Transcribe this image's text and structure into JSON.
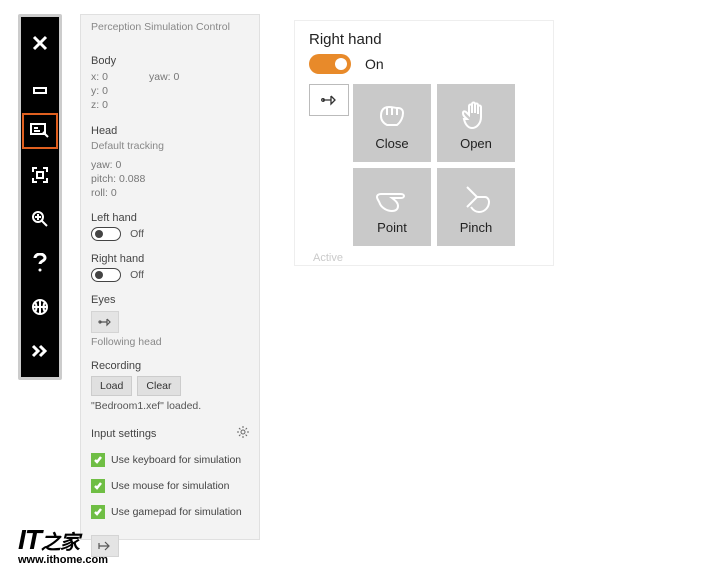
{
  "toolbar": {
    "items": [
      "close",
      "minimize",
      "perception",
      "fit-screen",
      "zoom",
      "help",
      "globe",
      "expand"
    ]
  },
  "panel": {
    "title": "Perception Simulation Control",
    "body": {
      "heading": "Body",
      "x_label": "x:",
      "x_val": "0",
      "y_label": "y:",
      "y_val": "0",
      "z_label": "z:",
      "z_val": "0",
      "yaw_label": "yaw:",
      "yaw_val": "0"
    },
    "head": {
      "heading": "Head",
      "tracking": "Default tracking",
      "yaw_label": "yaw:",
      "yaw_val": "0",
      "pitch_label": "pitch:",
      "pitch_val": "0.088",
      "roll_label": "roll:",
      "roll_val": "0"
    },
    "left_hand": {
      "heading": "Left hand",
      "state": "Off"
    },
    "right_hand": {
      "heading": "Right hand",
      "state": "Off"
    },
    "eyes": {
      "heading": "Eyes",
      "state": "Following head"
    },
    "recording": {
      "heading": "Recording",
      "load": "Load",
      "clear": "Clear",
      "status": "\"Bedroom1.xef\" loaded."
    },
    "input": {
      "heading": "Input settings",
      "kb": "Use keyboard for simulation",
      "mouse": "Use mouse for simulation",
      "gamepad": "Use gamepad for simulation"
    }
  },
  "hand_panel": {
    "title": "Right hand",
    "toggle_label": "On",
    "gestures": {
      "close": "Close",
      "open": "Open",
      "point": "Point",
      "pinch": "Pinch"
    },
    "active": "Active"
  },
  "watermark": {
    "brand": "IT",
    "url": "www.ithome.com"
  }
}
